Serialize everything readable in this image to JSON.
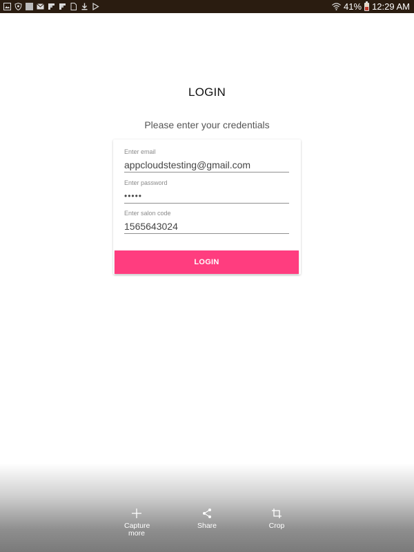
{
  "status_bar": {
    "battery": "41%",
    "battery_level": 0.41,
    "time": "12:29 AM",
    "icons_left": [
      "image-icon",
      "shield-icon",
      "square-icon",
      "email-icon",
      "flipboard-icon",
      "flipboard-icon",
      "document-icon",
      "download-icon",
      "play-store-icon"
    ],
    "icons_right": [
      "wifi-icon",
      "battery-icon"
    ]
  },
  "login": {
    "title": "LOGIN",
    "subtitle": "Please enter your credentials",
    "email": {
      "label": "Enter email",
      "value": "appcloudstesting@gmail.com"
    },
    "password": {
      "label": "Enter password",
      "value": "•••••"
    },
    "salon_code": {
      "label": "Enter salon code",
      "value": "1565643024"
    },
    "button_label": "LOGIN"
  },
  "capture_toolbar": {
    "capture_more": "Capture more",
    "share": "Share",
    "crop": "Crop"
  },
  "colors": {
    "status_bar": "#2a1c10",
    "accent": "#ff3d7f"
  }
}
